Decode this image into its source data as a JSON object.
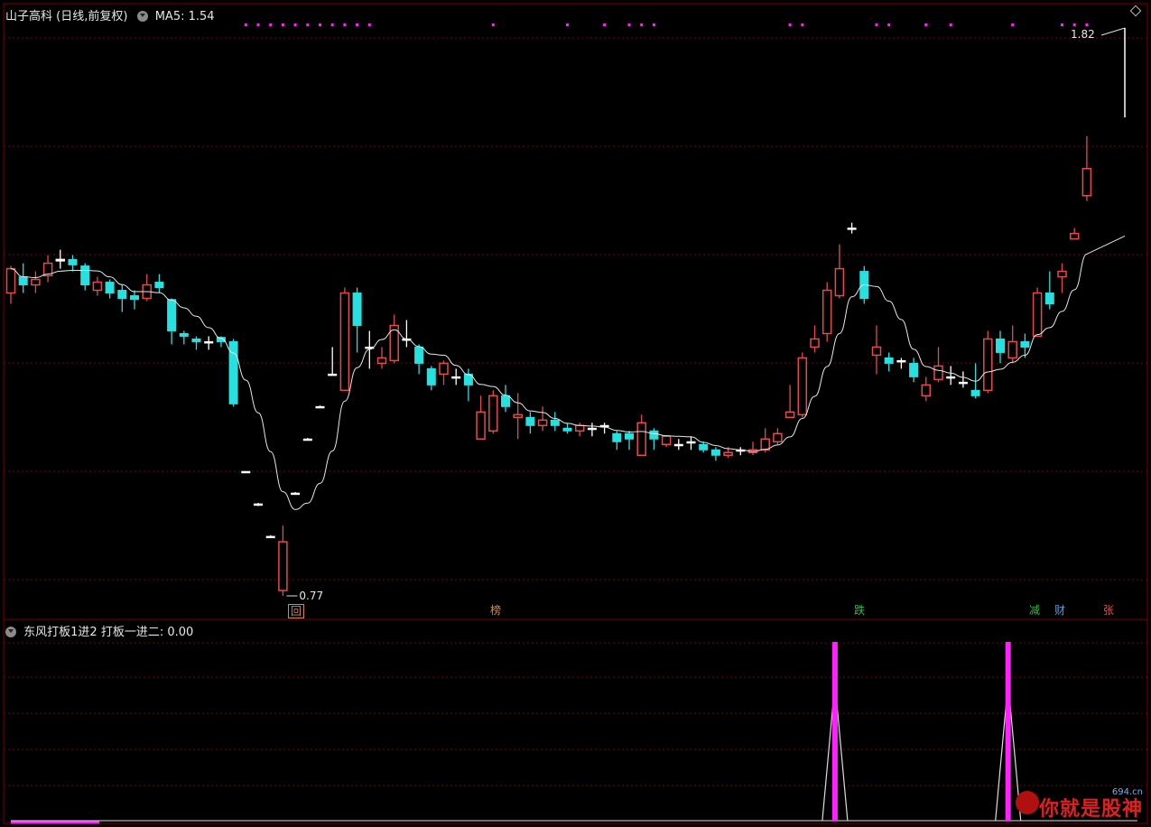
{
  "header": {
    "title": "山子高科 (日线,前复权)",
    "ma_label": "MA5: 1.54"
  },
  "sub_header": {
    "title": "东风打板1进2  打板一进二: 0.00"
  },
  "annotations": {
    "high_label": "1.82",
    "low_label": "0.77",
    "tag_hui": "回",
    "tag_bang": "榜",
    "tag_die": "跌",
    "tag_jian": "减",
    "tag_cai": "财",
    "tag_zhang": "张"
  },
  "watermark": {
    "text": "你就是股神",
    "url": "694.cn"
  },
  "colors": {
    "up": "#e84a4a",
    "down": "#27e0e0",
    "flat": "#ffffff",
    "ma": "#e8e8e8",
    "grid": "#7a0000",
    "signal": "#ff22ff"
  },
  "chart_data": {
    "type": "candlestick",
    "title": "山子高科 (日线,前复权)",
    "price_range": [
      0.77,
      1.82
    ],
    "x": [
      0,
      1,
      2,
      3,
      4,
      5,
      6,
      7,
      8,
      9,
      10,
      11,
      12,
      13,
      14,
      15,
      16,
      17,
      18,
      19,
      20,
      21,
      22,
      23,
      24,
      25,
      26,
      27,
      28,
      29,
      30,
      31,
      32,
      33,
      34,
      35,
      36,
      37,
      38,
      39,
      40,
      41,
      42,
      43,
      44,
      45,
      46,
      47,
      48,
      49,
      50,
      51,
      52,
      53,
      54,
      55,
      56,
      57,
      58,
      59,
      60,
      61,
      62,
      63,
      64,
      65,
      66,
      67,
      68,
      69,
      70,
      71,
      72,
      73,
      74,
      75,
      76,
      77,
      78,
      79,
      80,
      81,
      82,
      83,
      84,
      85,
      86,
      87
    ],
    "candles": [
      [
        1.33,
        1.375,
        1.38,
        1.31
      ],
      [
        1.36,
        1.345,
        1.385,
        1.33
      ],
      [
        1.345,
        1.355,
        1.37,
        1.33
      ],
      [
        1.362,
        1.385,
        1.4,
        1.35
      ],
      [
        1.39,
        1.392,
        1.41,
        1.375
      ],
      [
        1.392,
        1.382,
        1.4,
        1.37
      ],
      [
        1.38,
        1.345,
        1.385,
        1.335
      ],
      [
        1.335,
        1.35,
        1.36,
        1.325
      ],
      [
        1.35,
        1.33,
        1.355,
        1.32
      ],
      [
        1.335,
        1.32,
        1.345,
        1.295
      ],
      [
        1.325,
        1.318,
        1.335,
        1.3
      ],
      [
        1.32,
        1.345,
        1.365,
        1.315
      ],
      [
        1.35,
        1.34,
        1.365,
        1.33
      ],
      [
        1.318,
        1.26,
        1.32,
        1.235
      ],
      [
        1.255,
        1.25,
        1.26,
        1.235
      ],
      [
        1.245,
        1.24,
        1.25,
        1.225
      ],
      [
        1.24,
        1.24,
        1.25,
        1.225
      ],
      [
        1.248,
        1.24,
        1.25,
        1.23
      ],
      [
        1.24,
        1.125,
        1.245,
        1.12
      ],
      [
        1.0,
        1.0,
        1.0,
        1.0
      ],
      [
        0.94,
        0.938,
        0.942,
        0.936
      ],
      [
        0.88,
        0.88,
        0.882,
        0.878
      ],
      [
        0.78,
        0.87,
        0.9,
        0.77
      ],
      [
        0.96,
        0.96,
        0.962,
        0.958
      ],
      [
        1.06,
        1.06,
        1.062,
        1.058
      ],
      [
        1.12,
        1.12,
        1.122,
        1.118
      ],
      [
        1.18,
        1.18,
        1.23,
        1.178
      ],
      [
        1.15,
        1.33,
        1.34,
        1.15
      ],
      [
        1.33,
        1.27,
        1.34,
        1.22
      ],
      [
        1.23,
        1.23,
        1.26,
        1.19
      ],
      [
        1.2,
        1.21,
        1.23,
        1.19
      ],
      [
        1.205,
        1.27,
        1.29,
        1.2
      ],
      [
        1.245,
        1.245,
        1.28,
        1.23
      ],
      [
        1.23,
        1.2,
        1.235,
        1.18
      ],
      [
        1.19,
        1.16,
        1.195,
        1.15
      ],
      [
        1.18,
        1.2,
        1.205,
        1.16
      ],
      [
        1.175,
        1.175,
        1.19,
        1.16
      ],
      [
        1.18,
        1.16,
        1.19,
        1.13
      ],
      [
        1.06,
        1.11,
        1.14,
        1.065
      ],
      [
        1.075,
        1.14,
        1.15,
        1.07
      ],
      [
        1.14,
        1.12,
        1.16,
        1.11
      ],
      [
        1.1,
        1.105,
        1.145,
        1.06
      ],
      [
        1.1,
        1.085,
        1.11,
        1.07
      ],
      [
        1.085,
        1.095,
        1.12,
        1.075
      ],
      [
        1.095,
        1.085,
        1.11,
        1.075
      ],
      [
        1.08,
        1.075,
        1.09,
        1.07
      ],
      [
        1.075,
        1.085,
        1.09,
        1.065
      ],
      [
        1.08,
        1.08,
        1.09,
        1.065
      ],
      [
        1.085,
        1.085,
        1.09,
        1.07
      ],
      [
        1.07,
        1.055,
        1.075,
        1.04
      ],
      [
        1.07,
        1.06,
        1.075,
        1.04
      ],
      [
        1.03,
        1.09,
        1.105,
        1.03
      ],
      [
        1.075,
        1.06,
        1.08,
        1.04
      ],
      [
        1.05,
        1.065,
        1.065,
        1.045
      ],
      [
        1.05,
        1.05,
        1.06,
        1.04
      ],
      [
        1.055,
        1.055,
        1.065,
        1.04
      ],
      [
        1.05,
        1.04,
        1.055,
        1.035
      ],
      [
        1.04,
        1.03,
        1.045,
        1.02
      ],
      [
        1.03,
        1.035,
        1.045,
        1.025
      ],
      [
        1.04,
        1.04,
        1.045,
        1.03
      ],
      [
        1.035,
        1.04,
        1.055,
        1.03
      ],
      [
        1.04,
        1.06,
        1.08,
        1.035
      ],
      [
        1.055,
        1.07,
        1.08,
        1.05
      ],
      [
        1.1,
        1.11,
        1.16,
        1.1
      ],
      [
        1.105,
        1.21,
        1.22,
        1.1
      ],
      [
        1.23,
        1.245,
        1.27,
        1.22
      ],
      [
        1.255,
        1.335,
        1.35,
        1.24
      ],
      [
        1.325,
        1.375,
        1.42,
        1.32
      ],
      [
        1.45,
        1.45,
        1.46,
        1.44
      ],
      [
        1.37,
        1.32,
        1.38,
        1.31
      ],
      [
        1.215,
        1.23,
        1.27,
        1.18
      ],
      [
        1.21,
        1.2,
        1.22,
        1.185
      ],
      [
        1.205,
        1.205,
        1.21,
        1.19
      ],
      [
        1.2,
        1.175,
        1.21,
        1.165
      ],
      [
        1.14,
        1.16,
        1.175,
        1.13
      ],
      [
        1.17,
        1.195,
        1.23,
        1.165
      ],
      [
        1.175,
        1.175,
        1.195,
        1.16
      ],
      [
        1.165,
        1.165,
        1.185,
        1.155
      ],
      [
        1.15,
        1.14,
        1.2,
        1.135
      ],
      [
        1.15,
        1.245,
        1.26,
        1.145
      ],
      [
        1.245,
        1.22,
        1.26,
        1.2
      ],
      [
        1.21,
        1.24,
        1.27,
        1.2
      ],
      [
        1.24,
        1.23,
        1.255,
        1.21
      ],
      [
        1.25,
        1.33,
        1.34,
        1.25
      ],
      [
        1.33,
        1.31,
        1.37,
        1.3
      ],
      [
        1.36,
        1.37,
        1.385,
        1.33
      ],
      [
        1.43,
        1.44,
        1.45,
        1.43
      ],
      [
        1.51,
        1.56,
        1.62,
        1.5
      ]
    ],
    "ma5_label": "MA5: 1.54",
    "indicator": {
      "name": "东风打板1进2",
      "label": "打板一进二: 0.00",
      "signal_bars": [
        67,
        81
      ]
    }
  }
}
